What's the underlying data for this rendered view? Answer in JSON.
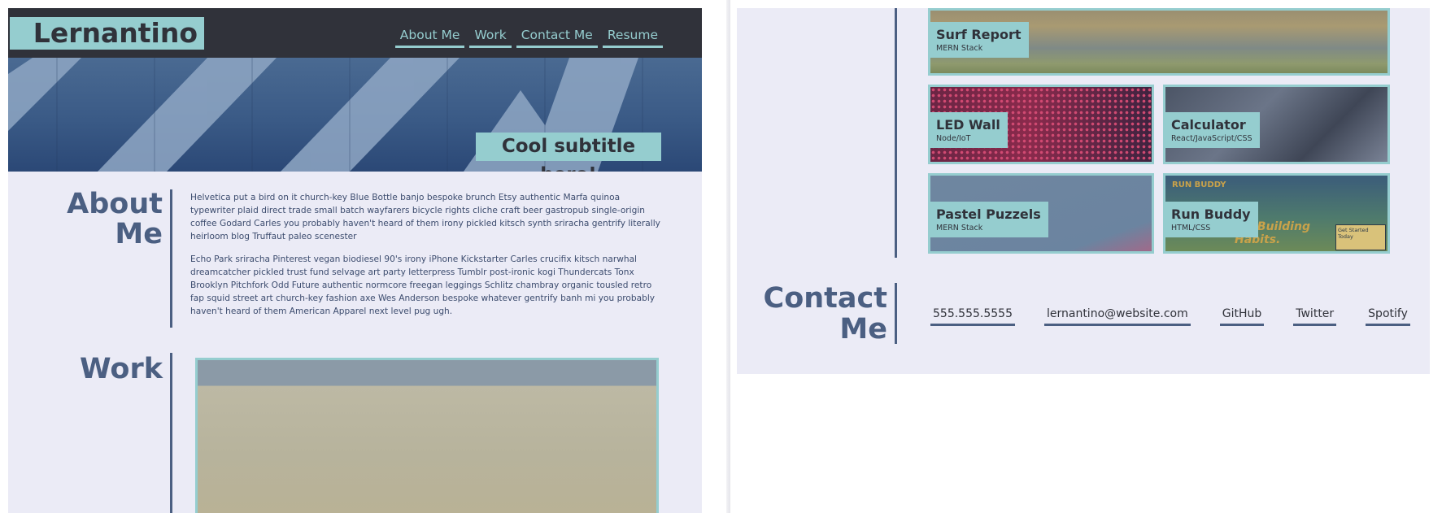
{
  "site": {
    "logo": "Lernantino",
    "nav": [
      "About Me",
      "Work",
      "Contact Me",
      "Resume"
    ],
    "hero_subtitle": "Cool subtitle here!"
  },
  "about": {
    "title_line1": "About",
    "title_line2": "Me",
    "paragraphs": [
      "Helvetica put a bird on it church-key Blue Bottle banjo bespoke brunch Etsy authentic Marfa quinoa typewriter plaid direct trade small batch wayfarers bicycle rights cliche craft beer gastropub single-origin coffee Godard Carles you probably haven't heard of them irony pickled kitsch synth sriracha gentrify literally heirloom blog Truffaut paleo scenester",
      "Echo Park sriracha Pinterest vegan biodiesel 90's irony iPhone Kickstarter Carles crucifix kitsch narwhal dreamcatcher pickled trust fund selvage art party letterpress Tumblr post-ironic kogi Thundercats Tonx Brooklyn Pitchfork Odd Future authentic normcore freegan leggings Schlitz chambray organic tousled retro fap squid street art church-key fashion axe Wes Anderson bespoke whatever gentrify banh mi you probably haven't heard of them American Apparel next level pug ugh."
    ]
  },
  "work": {
    "title": "Work",
    "projects": [
      {
        "name": "Surf Report",
        "stack": "MERN Stack"
      },
      {
        "name": "LED Wall",
        "stack": "Node/IoT"
      },
      {
        "name": "Calculator",
        "stack": "React/JavaScript/CSS"
      },
      {
        "name": "Pastel Puzzels",
        "stack": "MERN Stack"
      },
      {
        "name": "Run Buddy",
        "stack": "HTML/CSS"
      }
    ],
    "run_buddy_image": {
      "brand": "RUN BUDDY",
      "tagline": "art Building Habits.",
      "cta": "Get Started Today"
    }
  },
  "contact": {
    "title_line1": "Contact",
    "title_line2": "Me",
    "links": [
      "555.555.5555",
      "lernantino@website.com",
      "GitHub",
      "Twitter",
      "Spotify"
    ]
  },
  "colors": {
    "accent": "#95cdcf",
    "dark": "#30323a",
    "heading": "#4b5f82",
    "page_bg": "#ebebf6"
  }
}
